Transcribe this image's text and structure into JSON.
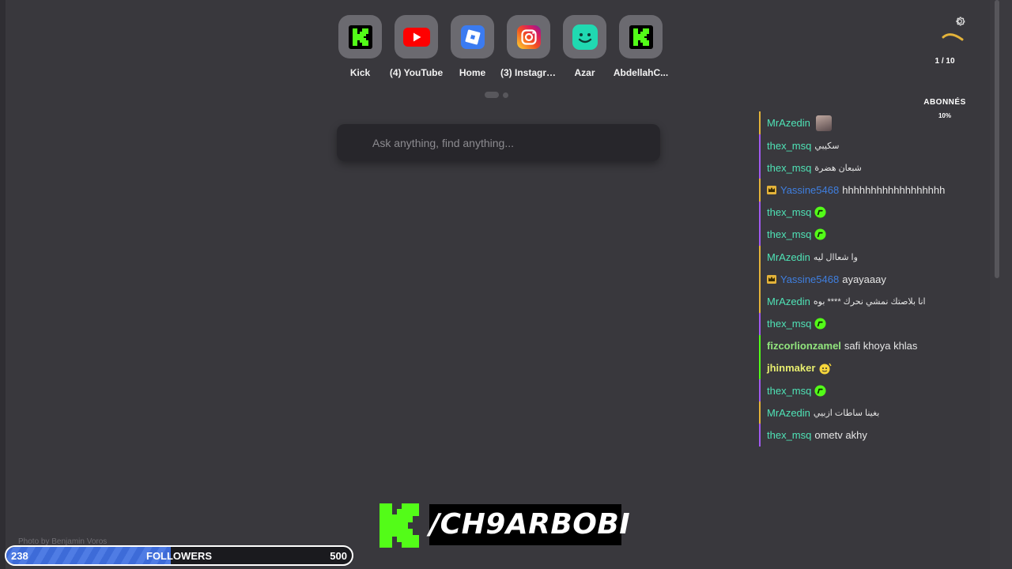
{
  "shortcuts": [
    {
      "label": "Kick",
      "icon": "kick-icon"
    },
    {
      "label": "(4) YouTube",
      "icon": "youtube-icon"
    },
    {
      "label": "Home",
      "icon": "roblox-icon"
    },
    {
      "label": "(3) Instagra...",
      "icon": "instagram-icon"
    },
    {
      "label": "Azar",
      "icon": "azar-icon"
    },
    {
      "label": "AbdellahC...",
      "icon": "kick-icon"
    }
  ],
  "search": {
    "placeholder": "Ask anything, find anything..."
  },
  "goal_widget": {
    "counter": "1 / 10",
    "title": "ABONNÉS",
    "percent": "10%",
    "progress_fraction": 0.1
  },
  "chat": [
    {
      "user": "MrAzedin",
      "text": "",
      "emote": "avatar-emote"
    },
    {
      "user": "thex_msq",
      "text": "سكيبي"
    },
    {
      "user": "thex_msq",
      "text": "شبعان هضرة"
    },
    {
      "user": "Yassine5468",
      "text": "hhhhhhhhhhhhhhhhhh",
      "badge": "crown-icon"
    },
    {
      "user": "thex_msq",
      "text": "",
      "emote": "kick-emote"
    },
    {
      "user": "thex_msq",
      "text": "",
      "emote": "kick-emote"
    },
    {
      "user": "MrAzedin",
      "text": "وا شعاال ليه"
    },
    {
      "user": "Yassine5468",
      "text": "ayayaaay",
      "badge": "crown-icon"
    },
    {
      "user": "MrAzedin",
      "text": "انا بلاصتك نمشي نحرك **** بوه"
    },
    {
      "user": "thex_msq",
      "text": "",
      "emote": "kick-emote"
    },
    {
      "user": "fizcorlionzamel",
      "text": "safi khoya khlas"
    },
    {
      "user": "jhinmaker",
      "text": "",
      "emote": "smiley-emote"
    },
    {
      "user": "thex_msq",
      "text": "",
      "emote": "kick-emote"
    },
    {
      "user": "MrAzedin",
      "text": "بغينا ساطات ازبيي"
    },
    {
      "user": "thex_msq",
      "text": "ometv akhy"
    }
  ],
  "photo_credit": "Photo by Benjamin Voros",
  "followers_bar": {
    "current": "238",
    "label": "FOLLOWERS",
    "goal": "500",
    "progress_fraction": 0.476
  },
  "channel_handle": "/CH9ARBOBI",
  "colors": {
    "kick_green": "#53fc18",
    "background": "#39383d",
    "progress_blue": "#3d6bd8"
  }
}
